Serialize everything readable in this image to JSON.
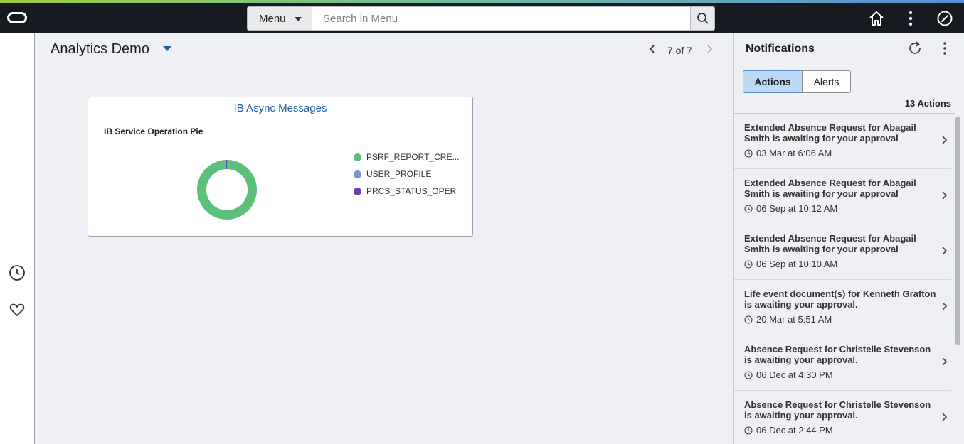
{
  "header": {
    "menu_label": "Menu",
    "search_placeholder": "Search in Menu"
  },
  "page": {
    "title": "Analytics Demo",
    "pager": "7 of 7"
  },
  "tile": {
    "title": "IB Async Messages",
    "chart_title": "IB Service Operation Pie"
  },
  "chart_data": {
    "type": "pie",
    "title": "IB Service Operation Pie",
    "categories": [
      "PSRF_REPORT_CRE...",
      "USER_PROFILE",
      "PRCS_STATUS_OPER"
    ],
    "values": [
      98.8,
      0.6,
      0.6
    ],
    "colors": [
      "#5cc07a",
      "#7b93d6",
      "#6e3fb4"
    ],
    "legend": "right"
  },
  "notifications": {
    "title": "Notifications",
    "tab_actions": "Actions",
    "tab_alerts": "Alerts",
    "count": "13 Actions",
    "items": [
      {
        "text": "Extended Absence Request for Abagail Smith is awaiting for your approval",
        "time": "03 Mar at 6:06 AM"
      },
      {
        "text": "Extended Absence Request for Abagail Smith is awaiting for your approval",
        "time": "06 Sep at 10:12 AM"
      },
      {
        "text": "Extended Absence Request for Abagail Smith is awaiting for your approval",
        "time": "06 Sep at 10:10 AM"
      },
      {
        "text": "Life event document(s) for Kenneth Grafton is awaiting your approval.",
        "time": "20 Mar at 5:51 AM"
      },
      {
        "text": "Absence Request for Christelle Stevenson is awaiting your approval.",
        "time": "06 Dec at 4:30 PM"
      },
      {
        "text": "Absence Request for Christelle Stevenson is awaiting your approval.",
        "time": "06 Dec at 2:44 PM"
      }
    ]
  }
}
